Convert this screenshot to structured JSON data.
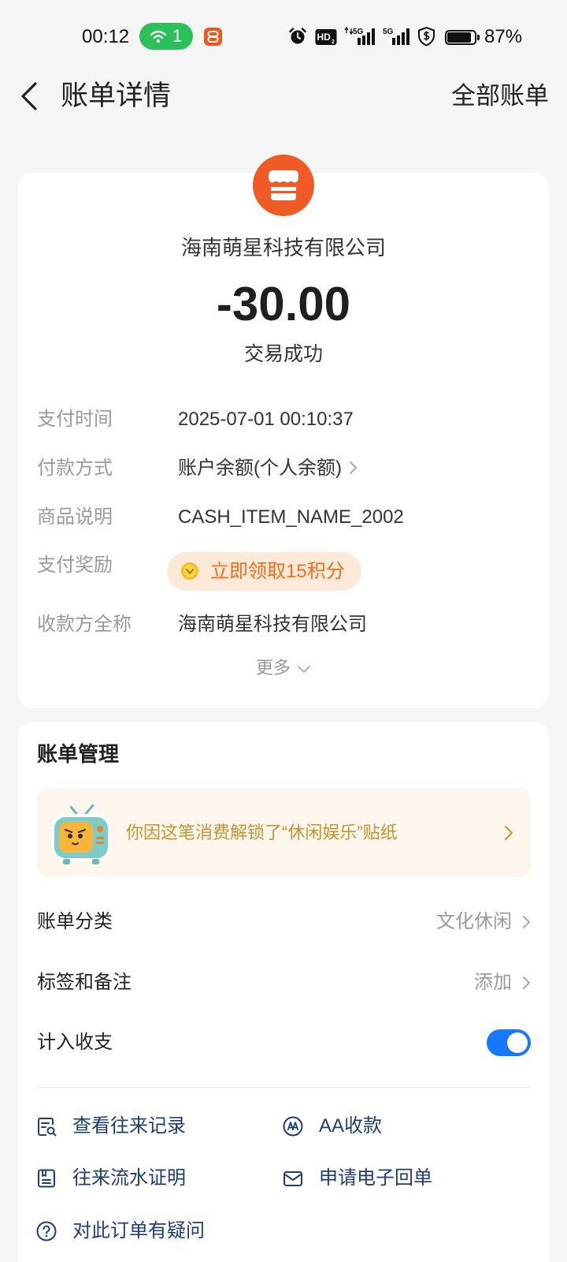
{
  "status_bar": {
    "time": "00:12",
    "hotspot_count": "1",
    "hd_label": "HD",
    "hd_sub": "2",
    "sim1_network": "5G",
    "sim2_network": "5G",
    "battery_percent": "87%",
    "icons": [
      "hotspot-icon",
      "app-notification-icon",
      "alarm-icon",
      "hd-volte-icon",
      "signal-icon",
      "signal-icon",
      "shield-icon",
      "battery-icon"
    ]
  },
  "header": {
    "back_icon": "chevron-left-icon",
    "title": "账单详情",
    "all_bills_link": "全部账单"
  },
  "summary": {
    "merchant_icon": "store-icon",
    "merchant_name": "海南萌星科技有限公司",
    "amount": "-30.00",
    "status": "交易成功"
  },
  "details": [
    {
      "label": "支付时间",
      "value": "2025-07-01 00:10:37"
    },
    {
      "label": "付款方式",
      "value": "账户余额(个人余额)"
    },
    {
      "label": "商品说明",
      "value": "CASH_ITEM_NAME_2002"
    },
    {
      "label": "支付奖励",
      "value": "立即领取15积分",
      "icon": "coin-icon"
    },
    {
      "label": "收款方全称",
      "value": "海南萌星科技有限公司"
    }
  ],
  "more_label": "更多",
  "management": {
    "title": "账单管理",
    "sticker_banner": {
      "icon": "tv-sticker-icon",
      "text": "你因这笔消费解锁了“休闲娱乐”贴纸"
    },
    "rows": [
      {
        "label": "账单分类",
        "value": "文化休闲"
      },
      {
        "label": "标签和备注",
        "value": "添加"
      },
      {
        "label": "计入收支",
        "toggle_on": true
      }
    ],
    "actions": [
      {
        "label": "查看往来记录",
        "icon": "record-search-icon"
      },
      {
        "label": "AA收款",
        "icon": "aa-collect-icon"
      },
      {
        "label": "往来流水证明",
        "icon": "statement-document-icon"
      },
      {
        "label": "申请电子回单",
        "icon": "mail-icon"
      },
      {
        "label": "对此订单有疑问",
        "icon": "question-icon"
      }
    ]
  },
  "colors": {
    "accent": "#1677ff",
    "merchant": "#f05a24",
    "reward_text": "#f06d1f",
    "reward_bg": "#fde9d8",
    "banner_text": "#c8932f",
    "banner_bg": "#fcf6ec",
    "action_text": "#1e3d73",
    "hotspot": "#2cc05a",
    "app_badge": "#f2561d"
  }
}
